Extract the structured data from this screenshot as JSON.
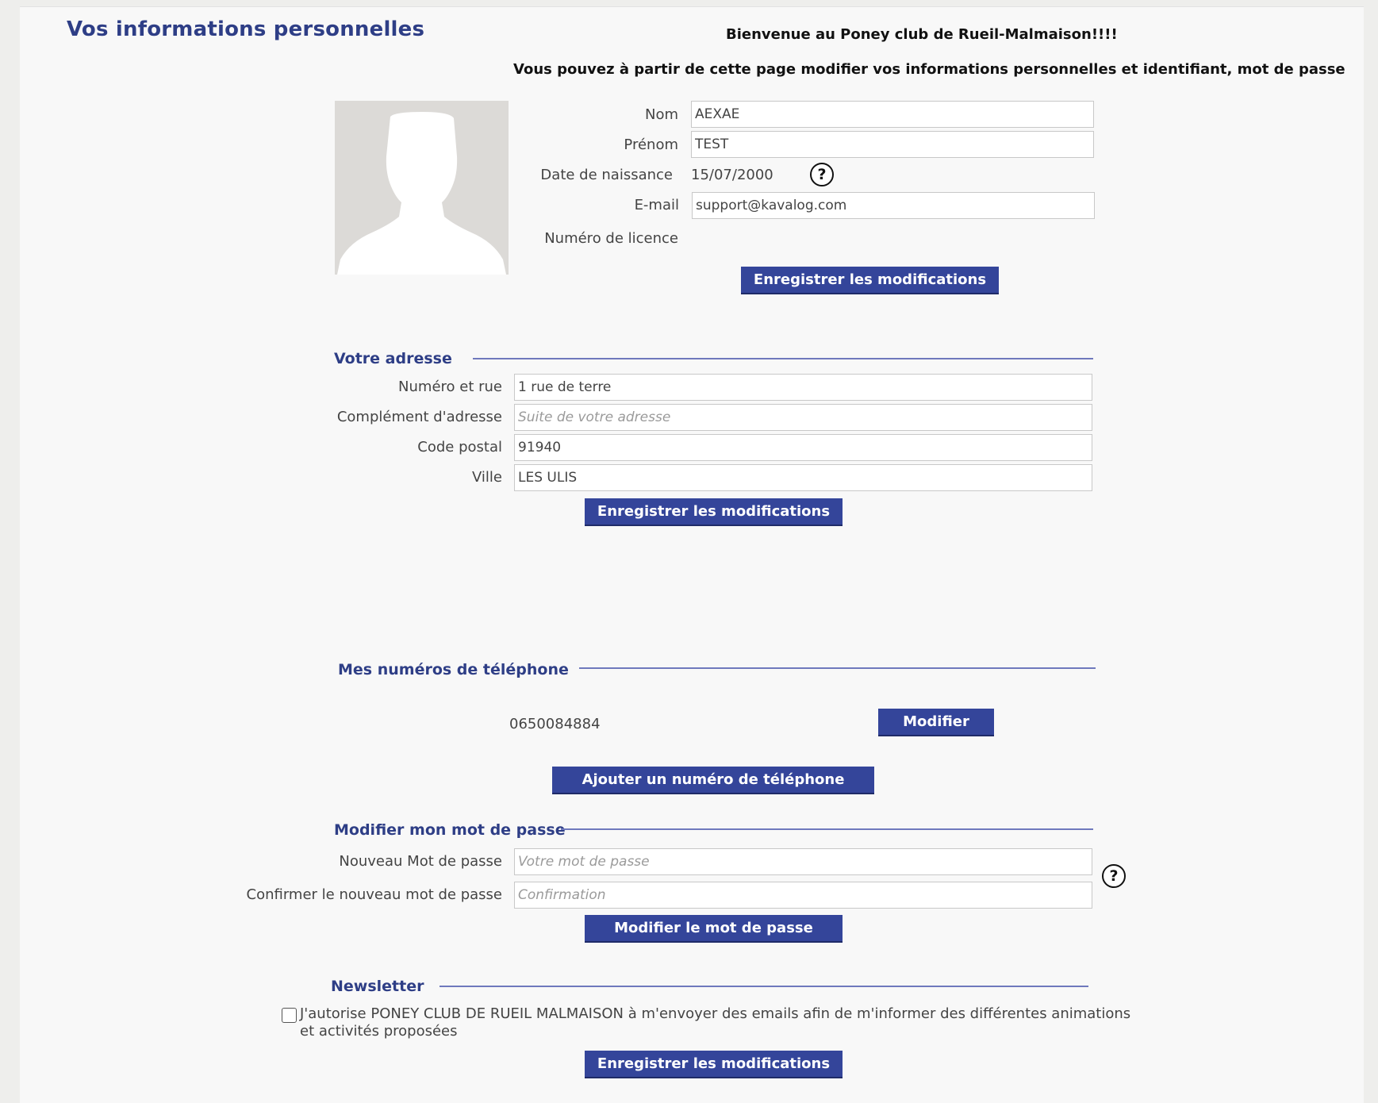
{
  "page": {
    "title": "Vos informations personnelles",
    "welcome": "Bienvenue au Poney club de Rueil-Malmaison!!!!",
    "intro": "Vous pouvez à partir de cette page modifier vos informations personnelles et identifiant, mot de passe"
  },
  "identity": {
    "avatar_icon": "user-silhouette-icon",
    "nom_label": "Nom",
    "nom_value": "AEXAE",
    "prenom_label": "Prénom",
    "prenom_value": "TEST",
    "birth_label": "Date de naissance",
    "birth_value": "15/07/2000",
    "help_glyph": "?",
    "email_label": "E-mail",
    "email_value": "support@kavalog.com",
    "licence_label": "Numéro de licence",
    "save_label": "Enregistrer les modifications"
  },
  "address": {
    "title": "Votre adresse",
    "street_label": "Numéro et rue",
    "street_value": "1 rue de terre",
    "complement_label": "Complément d'adresse",
    "complement_placeholder": "Suite de votre adresse",
    "postal_label": "Code postal",
    "postal_value": "91940",
    "city_label": "Ville",
    "city_value": "LES ULIS",
    "save_label": "Enregistrer les modifications"
  },
  "phones": {
    "title": "Mes numéros de téléphone",
    "items": [
      {
        "number": "0650084884",
        "edit_label": "Modifier"
      }
    ],
    "add_label": "Ajouter un numéro de téléphone"
  },
  "password": {
    "title": "Modifier mon mot de passe",
    "new_label": "Nouveau Mot de passe",
    "new_placeholder": "Votre mot de passe",
    "confirm_label": "Confirmer le nouveau mot de passe",
    "confirm_placeholder": "Confirmation",
    "help_glyph": "?",
    "submit_label": "Modifier le mot de passe"
  },
  "newsletter": {
    "title": "Newsletter",
    "consent_text": "J'autorise PONEY CLUB DE RUEIL MALMAISON à m'envoyer des emails afin de m'informer des différentes animations et activités proposées",
    "checked": false,
    "save_label": "Enregistrer les modifications"
  },
  "colors": {
    "accent": "#34459a",
    "title": "#2e3e86",
    "background": "#f8f8f8"
  }
}
